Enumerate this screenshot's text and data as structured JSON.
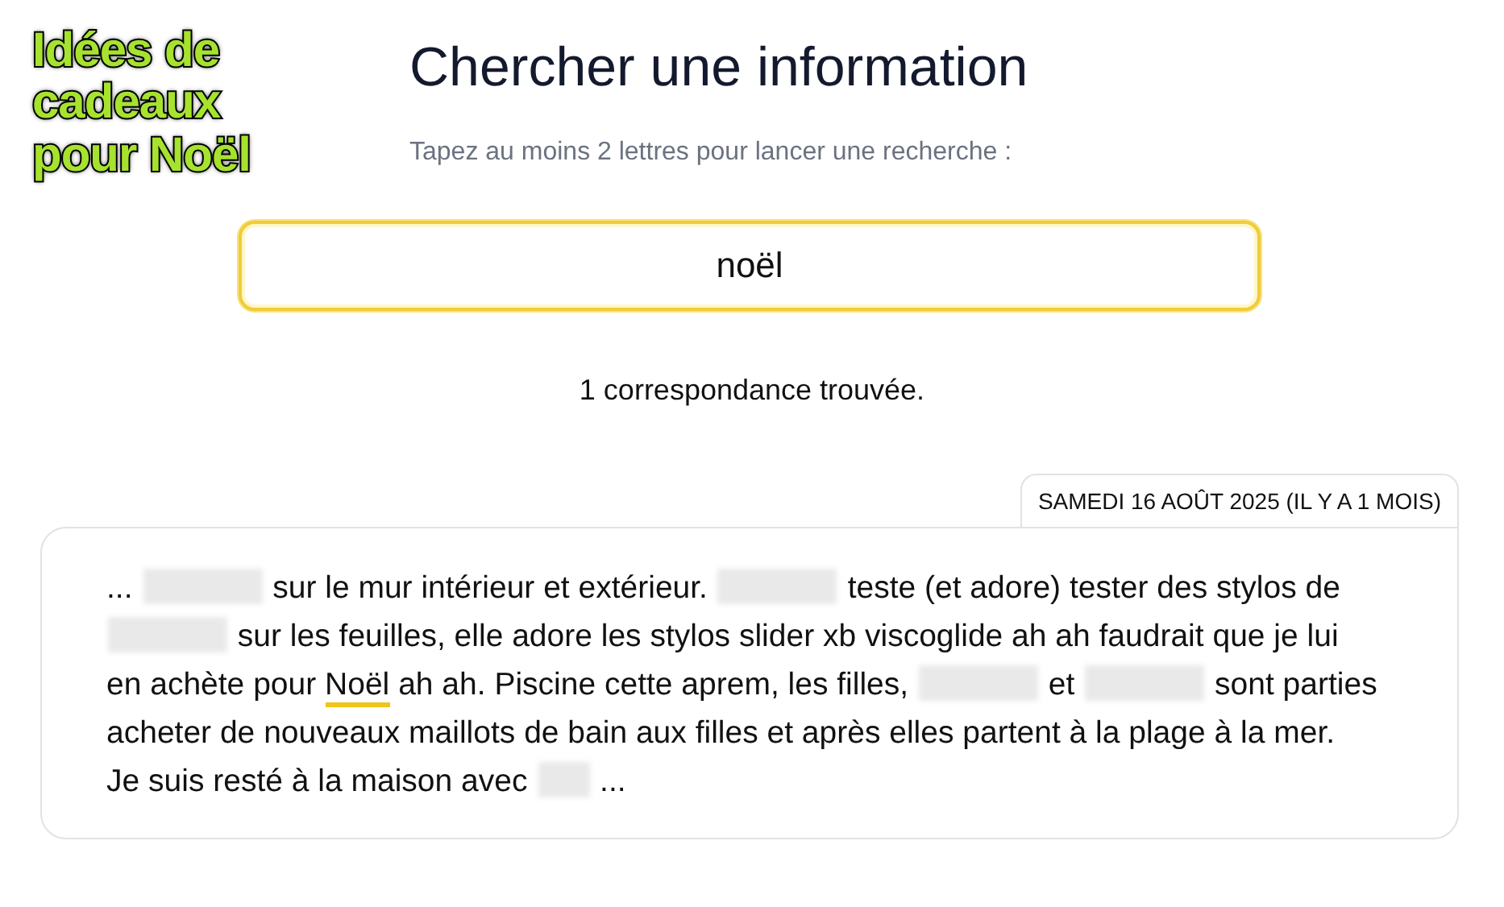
{
  "caption": "Idées de cadeaux pour Noël",
  "title": "Chercher une information",
  "hint": "Tapez au moins 2 lettres pour lancer une recherche :",
  "search": {
    "value": "noël"
  },
  "result_count": "1 correspondance trouvée.",
  "entry": {
    "date": "SAMEDI 16 AOÛT 2025 (IL Y A 1 MOIS)",
    "lines": [
      [
        {
          "kind": "text",
          "text": "..."
        },
        {
          "kind": "redacted"
        },
        {
          "kind": "text",
          "text": "sur le mur intérieur et extérieur."
        },
        {
          "kind": "redacted"
        },
        {
          "kind": "text",
          "text": "teste (et adore) tester des stylos de"
        }
      ],
      [
        {
          "kind": "redacted"
        },
        {
          "kind": "text",
          "text": "sur les feuilles, elle adore les stylos slider xb viscoglide ah ah faudrait que je lui"
        }
      ],
      [
        {
          "kind": "text",
          "text": "en achète pour"
        },
        {
          "kind": "match",
          "text": "Noël"
        },
        {
          "kind": "text",
          "text": "ah ah. Piscine cette aprem, les filles,"
        },
        {
          "kind": "redacted"
        },
        {
          "kind": "text",
          "text": "et"
        },
        {
          "kind": "redacted"
        },
        {
          "kind": "text",
          "text": "sont parties"
        }
      ],
      [
        {
          "kind": "text",
          "text": "acheter de nouveaux maillots de bain aux filles et après elles partent à la plage à la mer."
        }
      ],
      [
        {
          "kind": "text",
          "text": "Je suis resté à la maison avec"
        },
        {
          "kind": "redacted_short"
        },
        {
          "kind": "text",
          "text": "..."
        }
      ]
    ]
  }
}
